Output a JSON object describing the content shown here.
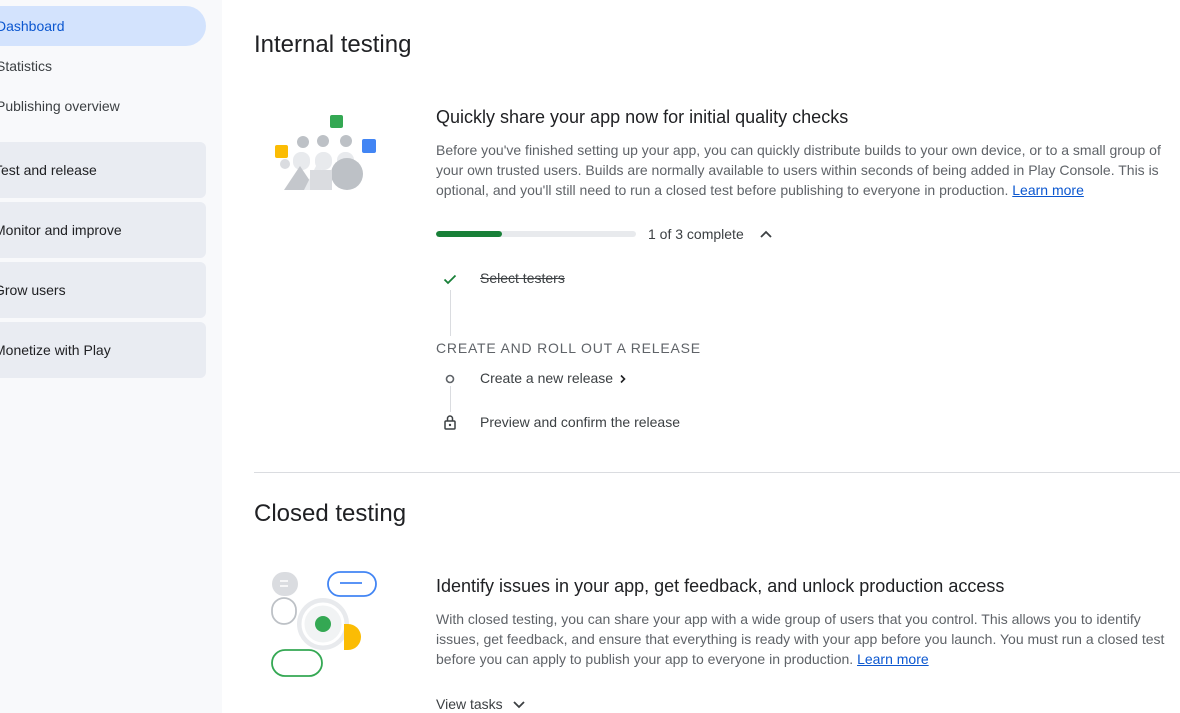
{
  "sidebar": {
    "items": [
      {
        "label": "Dashboard",
        "active": true
      },
      {
        "label": "Statistics"
      },
      {
        "label": "Publishing overview"
      }
    ],
    "groups": [
      {
        "label": "Test and release"
      },
      {
        "label": "Monitor and improve"
      },
      {
        "label": "Grow users"
      },
      {
        "label": "Monetize with Play"
      }
    ]
  },
  "internal": {
    "section_title": "Internal testing",
    "card_title": "Quickly share your app now for initial quality checks",
    "description": "Before you've finished setting up your app, you can quickly distribute builds to your own device, or to a small group of your own trusted users. Builds are normally available to users within seconds of being added in Play Console. This is optional, and you'll still need to run a closed test before publishing to everyone in production.",
    "learn_more": "Learn more",
    "progress_fraction": 0.33,
    "progress_text": "1 of 3 complete",
    "tasks": {
      "select_testers": "Select testers",
      "group_label": "CREATE AND ROLL OUT A RELEASE",
      "create_release": "Create a new release",
      "preview_release": "Preview and confirm the release"
    }
  },
  "closed": {
    "section_title": "Closed testing",
    "card_title": "Identify issues in your app, get feedback, and unlock production access",
    "description": "With closed testing, you can share your app with a wide group of users that you control. This allows you to identify issues, get feedback, and ensure that everything is ready with your app before you launch. You must run a closed test before you can apply to publish your app to everyone in production.",
    "learn_more": "Learn more",
    "view_tasks": "View tasks"
  },
  "icons": {
    "check": "check-icon",
    "circle": "step-circle-icon",
    "lock": "lock-icon",
    "chevron_up": "chevron-up-icon",
    "chevron_down": "chevron-down-icon",
    "chevron_right": "chevron-right-icon"
  },
  "colors": {
    "active_nav_bg": "#d3e3fd",
    "active_nav_text": "#0b57d0",
    "progress": "#188038",
    "link": "#0b57d0",
    "green": "#34a853",
    "yellow": "#fbbc04",
    "blue": "#4285f4"
  }
}
